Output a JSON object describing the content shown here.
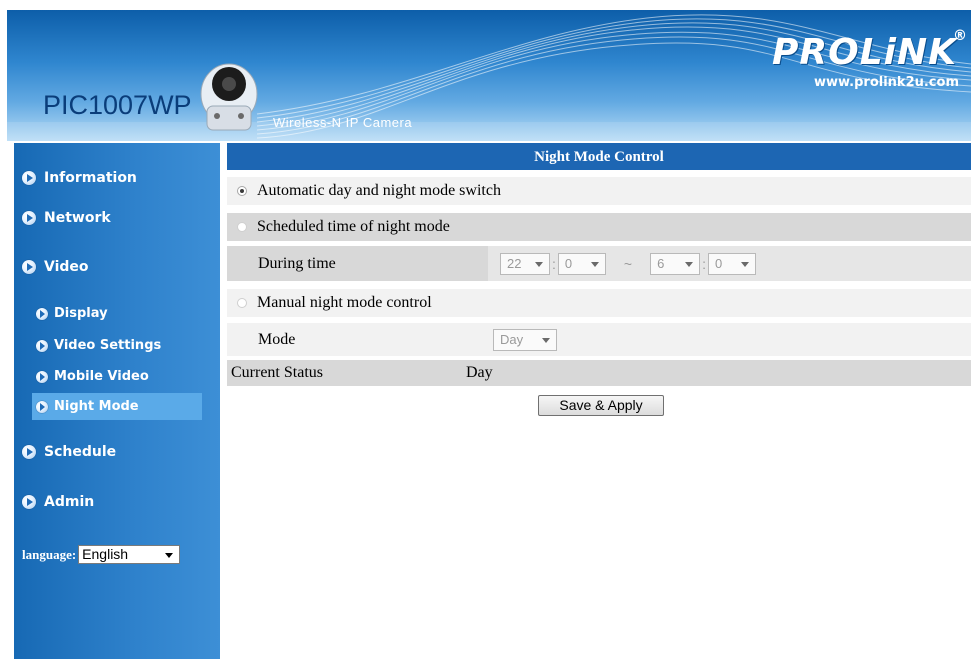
{
  "header": {
    "model": "PIC1007WP",
    "subtitle": "Wireless-N IP Camera",
    "brand": "PROLiNK",
    "brand_mark": "®",
    "url": "www.prolink2u.com"
  },
  "sidebar": {
    "items": [
      {
        "label": "Information"
      },
      {
        "label": "Network"
      },
      {
        "label": "Video"
      },
      {
        "label": "Display"
      },
      {
        "label": "Video Settings"
      },
      {
        "label": "Mobile Video"
      },
      {
        "label": "Night Mode"
      },
      {
        "label": "Schedule"
      },
      {
        "label": "Admin"
      }
    ],
    "active": "Night Mode",
    "language_label": "language:",
    "language_value": "English"
  },
  "main": {
    "title": "Night Mode Control",
    "auto_label": "Automatic day and night mode switch",
    "scheduled_label": "Scheduled time of night mode",
    "during_label": "During time",
    "start_hour": "22",
    "start_minute": "0",
    "tilde": "~",
    "end_hour": "6",
    "end_minute": "0",
    "colon": ":",
    "manual_label": "Manual night mode control",
    "mode_label": "Mode",
    "mode_value": "Day",
    "status_label": "Current Status",
    "status_value": "Day",
    "save_label": "Save & Apply",
    "selected_option": "Automatic day and night mode switch"
  },
  "colors": {
    "title_bar": "#1d66b3",
    "sidebar": "#2f82cc",
    "active_item": "#5aaae8"
  }
}
